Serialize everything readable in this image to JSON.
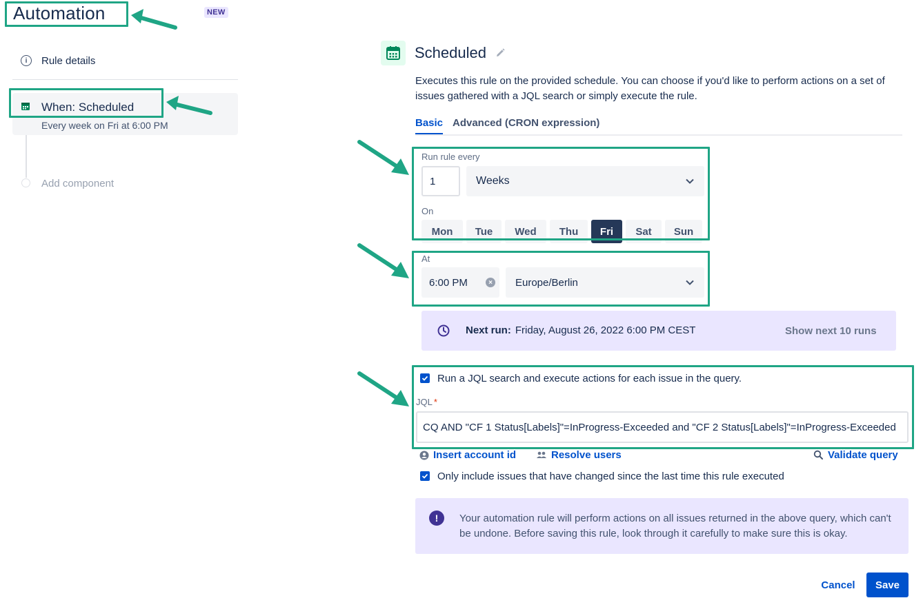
{
  "sidebar": {
    "app_title": "Automation",
    "new_badge": "NEW",
    "rule_details_label": "Rule details",
    "trigger": {
      "title": "When: Scheduled",
      "subtitle": "Every week on Fri at 6:00 PM"
    },
    "add_component_label": "Add component"
  },
  "header": {
    "title": "Scheduled",
    "description": "Executes this rule on the provided schedule. You can choose if you'd like to perform actions on a set of issues gathered with a JQL search or simply execute the rule."
  },
  "tabs": [
    {
      "label": "Basic",
      "active": true
    },
    {
      "label": "Advanced (CRON expression)",
      "active": false
    }
  ],
  "schedule": {
    "run_every_label": "Run rule every",
    "interval_value": "1",
    "interval_unit": "Weeks",
    "on_label": "On",
    "days": [
      {
        "label": "Mon",
        "selected": false
      },
      {
        "label": "Tue",
        "selected": false
      },
      {
        "label": "Wed",
        "selected": false
      },
      {
        "label": "Thu",
        "selected": false
      },
      {
        "label": "Fri",
        "selected": true
      },
      {
        "label": "Sat",
        "selected": false
      },
      {
        "label": "Sun",
        "selected": false
      }
    ],
    "at_label": "At",
    "time_value": "6:00 PM",
    "timezone": "Europe/Berlin"
  },
  "next_run": {
    "label": "Next run:",
    "value": "Friday, August 26, 2022 6:00 PM CEST",
    "show_next_label": "Show next 10 runs"
  },
  "jql": {
    "run_jql_checkbox_label": "Run a JQL search and execute actions for each issue in the query.",
    "run_jql_checked": true,
    "label": "JQL",
    "required_mark": "*",
    "query": "CQ AND \"CF 1 Status[Labels]\"=InProgress-Exceeded and \"CF 2 Status[Labels]\"=InProgress-Exceeded",
    "insert_account_label": "Insert account id",
    "resolve_users_label": "Resolve users",
    "validate_query_label": "Validate query",
    "only_changed_label": "Only include issues that have changed since the last time this rule executed",
    "only_changed_checked": true
  },
  "warning": {
    "text": "Your automation rule will perform actions on all issues returned in the above query, which can't be undone. Before saving this rule, look through it carefully to make sure this is okay."
  },
  "footer": {
    "cancel_label": "Cancel",
    "save_label": "Save"
  },
  "colors": {
    "primary": "#0052cc",
    "annotation": "#1fa585",
    "selected_day": "#253858",
    "info_panel": "#eae6ff",
    "calendar_green": "#00875a"
  }
}
